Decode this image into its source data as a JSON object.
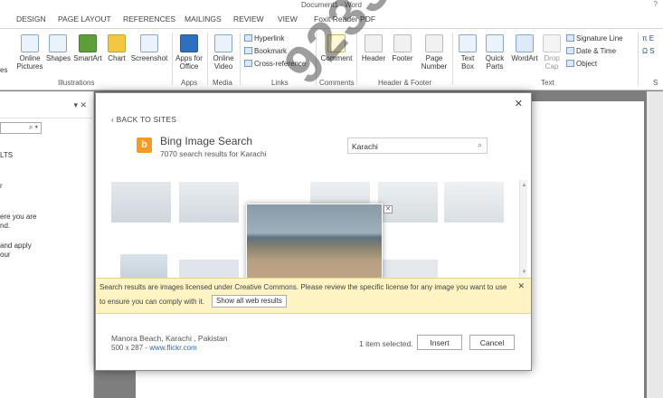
{
  "window": {
    "title": "Document1 - Word",
    "help": "?"
  },
  "tabs": [
    "DESIGN",
    "PAGE LAYOUT",
    "REFERENCES",
    "MAILINGS",
    "REVIEW",
    "VIEW",
    "Foxit Reader PDF"
  ],
  "ribbon": {
    "illustrations": {
      "online_pictures": "Online Pictures",
      "shapes": "Shapes",
      "smartart": "SmartArt",
      "chart": "Chart",
      "screenshot": "Screenshot",
      "group_label": "Illustrations"
    },
    "apps": {
      "apps_for_office": "Apps for Office",
      "group_label": "Apps"
    },
    "media": {
      "online_video": "Online Video",
      "group_label": "Media"
    },
    "links": {
      "hyperlink": "Hyperlink",
      "bookmark": "Bookmark",
      "cross_reference": "Cross-reference",
      "group_label": "Links"
    },
    "comments": {
      "comment": "Comment",
      "group_label": "Comments"
    },
    "header_footer": {
      "header": "Header",
      "footer": "Footer",
      "page_number": "Page Number",
      "group_label": "Header & Footer"
    },
    "text": {
      "text_box": "Text Box",
      "quick_parts": "Quick Parts",
      "wordart": "WordArt",
      "drop_cap": "Drop Cap",
      "signature_line": "Signature Line",
      "date_time": "Date & Time",
      "object": "Object",
      "group_label": "Text"
    },
    "symbols": {
      "equation": "π E",
      "symbol": "Ω S",
      "group_label": "S"
    },
    "partial_left_label": "es"
  },
  "pane": {
    "lines": [
      "LTS",
      "r",
      "ere you are",
      "nd.",
      "and apply",
      "our"
    ]
  },
  "dialog": {
    "back_label": "‹ BACK TO SITES",
    "source_title": "Bing Image Search",
    "result_count": "7070 search results for Karachi",
    "search_value": "Karachi",
    "notice_text": "Search results are images licensed under Creative Commons. Please review the specific license for any image you want to use",
    "notice_text2": "to ensure you can comply with it.",
    "show_all_label": "Show all web results",
    "image_title": "Manora Beach,   Karachi   , Pakistan",
    "image_dims": "500 x 287 -",
    "image_link": "www.flickr.com",
    "selected_text": "1 item selected.",
    "insert_label": "Insert",
    "cancel_label": "Cancel"
  },
  "watermark": "923332161732 0",
  "colors": {
    "bing_orange": "#f79a21",
    "notice_bg": "#fdf3c3",
    "link": "#2b6cb0"
  }
}
